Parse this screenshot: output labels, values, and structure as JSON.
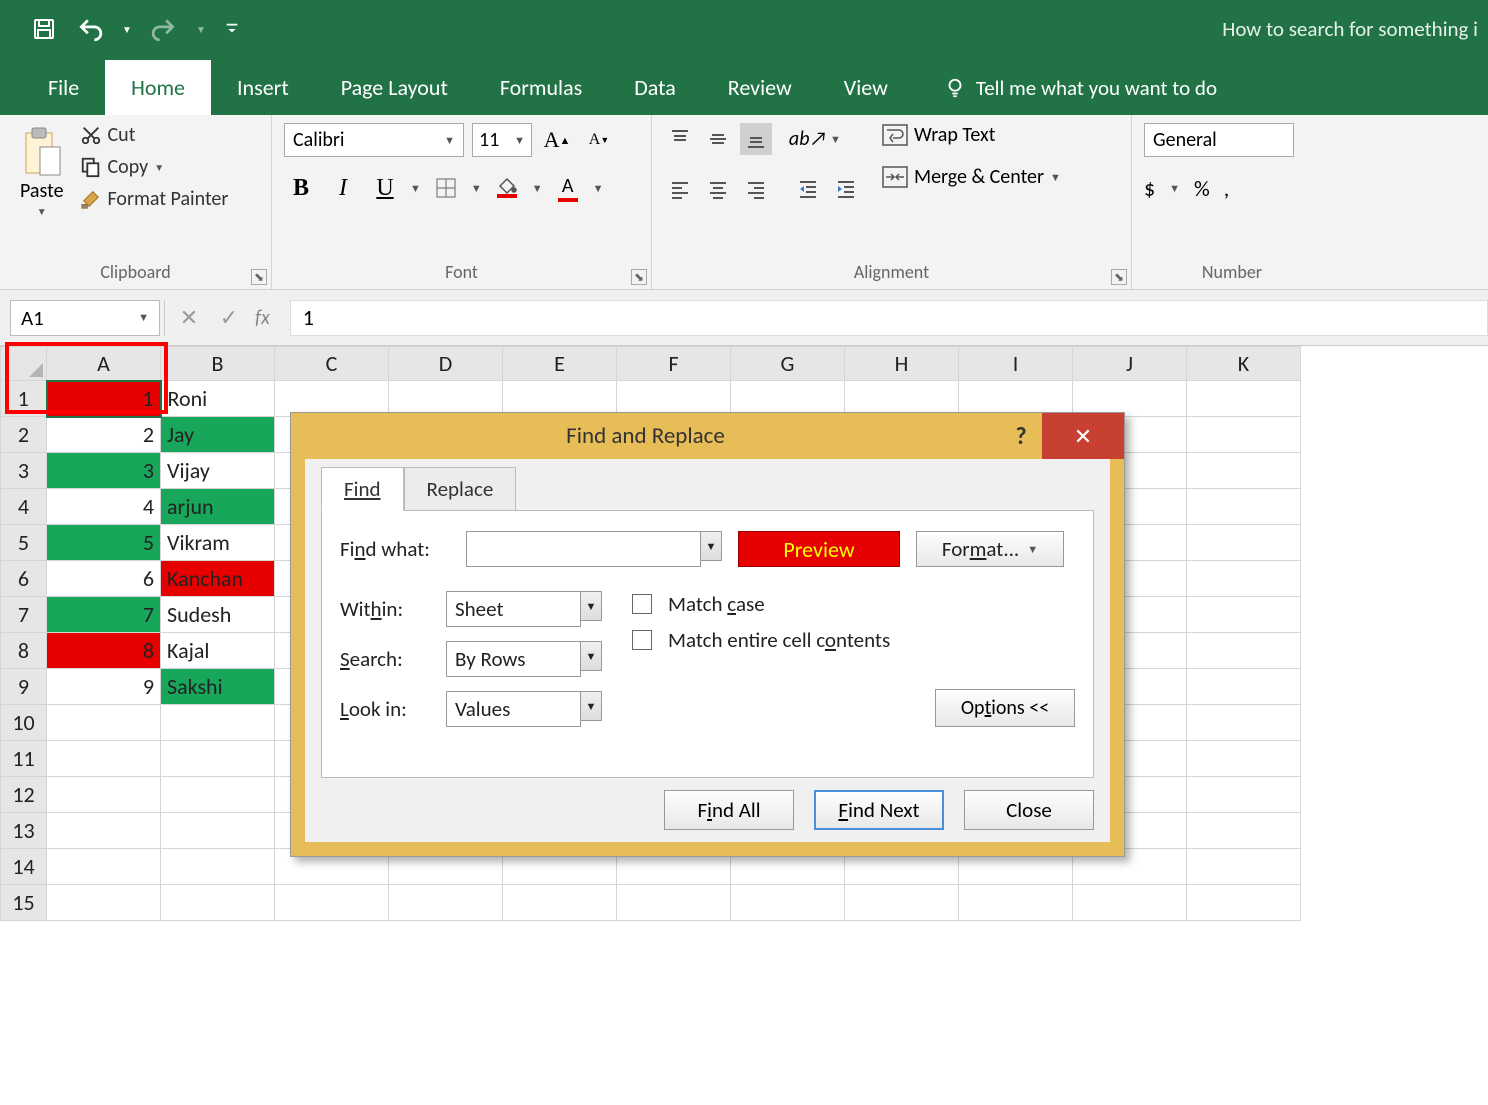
{
  "app": {
    "doc_title": "How to search for something i"
  },
  "qat": {
    "save": "save",
    "undo": "undo",
    "redo": "redo"
  },
  "tabs": {
    "file": "File",
    "home": "Home",
    "insert": "Insert",
    "page_layout": "Page Layout",
    "formulas": "Formulas",
    "data": "Data",
    "review": "Review",
    "view": "View",
    "tell_me": "Tell me what you want to do"
  },
  "ribbon": {
    "clipboard": {
      "paste": "Paste",
      "cut": "Cut",
      "copy": "Copy",
      "format_painter": "Format Painter",
      "label": "Clipboard"
    },
    "font": {
      "name": "Calibri",
      "size": "11",
      "label": "Font"
    },
    "alignment": {
      "wrap": "Wrap Text",
      "merge": "Merge & Center",
      "label": "Alignment"
    },
    "number": {
      "format": "General",
      "label": "Number"
    }
  },
  "formula_bar": {
    "name_box": "A1",
    "fx": "fx",
    "formula_value": "1"
  },
  "columns": [
    "A",
    "B",
    "C",
    "D",
    "E",
    "F",
    "G",
    "H",
    "I",
    "J",
    "K"
  ],
  "row_count": 15,
  "cells": [
    {
      "row": 1,
      "a": "1",
      "a_bg": "red",
      "b": "Roni",
      "b_bg": "white"
    },
    {
      "row": 2,
      "a": "2",
      "a_bg": "white",
      "b": "Jay",
      "b_bg": "green"
    },
    {
      "row": 3,
      "a": "3",
      "a_bg": "green",
      "b": "Vijay",
      "b_bg": "white"
    },
    {
      "row": 4,
      "a": "4",
      "a_bg": "white",
      "b": "arjun",
      "b_bg": "green"
    },
    {
      "row": 5,
      "a": "5",
      "a_bg": "green",
      "b": "Vikram",
      "b_bg": "white"
    },
    {
      "row": 6,
      "a": "6",
      "a_bg": "white",
      "b": "Kanchan",
      "b_bg": "redtxt"
    },
    {
      "row": 7,
      "a": "7",
      "a_bg": "green",
      "b": "Sudesh",
      "b_bg": "white"
    },
    {
      "row": 8,
      "a": "8",
      "a_bg": "red",
      "b": "Kajal",
      "b_bg": "white"
    },
    {
      "row": 9,
      "a": "9",
      "a_bg": "white",
      "b": "Sakshi",
      "b_bg": "green"
    }
  ],
  "dialog": {
    "title": "Find and Replace",
    "tab_find": "Find",
    "tab_replace": "Replace",
    "find_what_label": "Find what:",
    "find_what_value": "",
    "preview_label": "Preview",
    "format_label": "Format...",
    "within_label": "Within:",
    "within_value": "Sheet",
    "search_label": "Search:",
    "search_value": "By Rows",
    "lookin_label": "Look in:",
    "lookin_value": "Values",
    "match_case": "Match case",
    "match_entire": "Match entire cell contents",
    "options": "Options <<",
    "find_all": "Find All",
    "find_next": "Find Next",
    "close": "Close"
  }
}
